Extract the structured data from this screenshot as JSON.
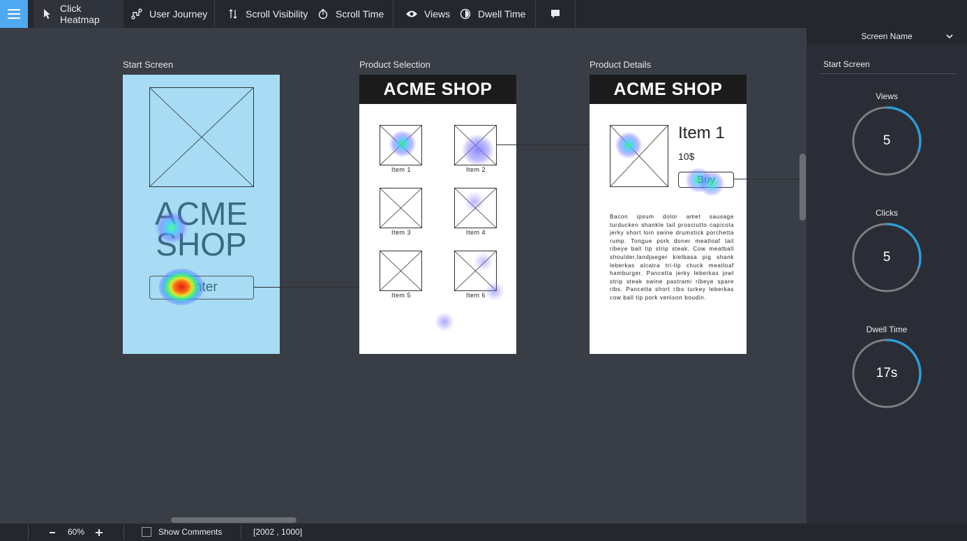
{
  "toolbar": {
    "click_heatmap": "Click Heatmap",
    "user_journey": "User Journey",
    "scroll_visibility": "Scroll Visibility",
    "scroll_time": "Scroll Time",
    "views": "Views",
    "dwell_time": "Dwell Time",
    "active_item": "click_heatmap"
  },
  "screens": {
    "start": {
      "label": "Start Screen",
      "brand_line1": "ACME",
      "brand_line2": "SHOP",
      "enter_label": "Enter"
    },
    "selection": {
      "label": "Product Selection",
      "header": "ACME SHOP",
      "items": [
        "Item 1",
        "Item 2",
        "Item 3",
        "Item 4",
        "Item 5",
        "Item 6"
      ]
    },
    "details": {
      "label": "Product Details",
      "header": "ACME SHOP",
      "title": "Item 1",
      "price": "10$",
      "buy_label": "Buy",
      "description": "Bacon ipsum dolor amet sausage turducken shankle tail prosciutto capicola jerky short loin swine drumstick porchetta rump. Tongue pork doner meatloaf tail ribeye ball tip strip steak. Cow meatball shoulder,landjaeger kielbasa pig shank leberkas alcatra tri-tip chuck meatloaf hamburger. Pancetta jerky leberkas jowl strip steak swine pastrami ribeye spare ribs. Pancetta short ribs turkey leberkas cow ball tip pork venison boudin."
    }
  },
  "sidebar": {
    "dropdown_label": "Screen Name",
    "selected_screen": "Start Screen",
    "metrics": [
      {
        "label": "Views",
        "value": "5",
        "fill": 0.3
      },
      {
        "label": "Clicks",
        "value": "5",
        "fill": 0.3
      },
      {
        "label": "Dwell Time",
        "value": "17s",
        "fill": 0.3
      }
    ]
  },
  "bottombar": {
    "zoom": "60%",
    "show_comments": "Show Comments",
    "coords": "[2002 , 1000]"
  },
  "colors": {
    "accent": "#4ea9f0",
    "gauge_fill": "#2f9bd6",
    "gauge_track": "#7a7e85",
    "start_screen_bg": "#a7dcf4"
  },
  "icons": [
    "menu-icon",
    "cursor-icon",
    "journey-icon",
    "scroll-arrows-icon",
    "stopwatch-icon",
    "eye-icon",
    "dwell-icon",
    "comment-icon",
    "chevron-down-icon",
    "minus-icon",
    "plus-icon"
  ]
}
